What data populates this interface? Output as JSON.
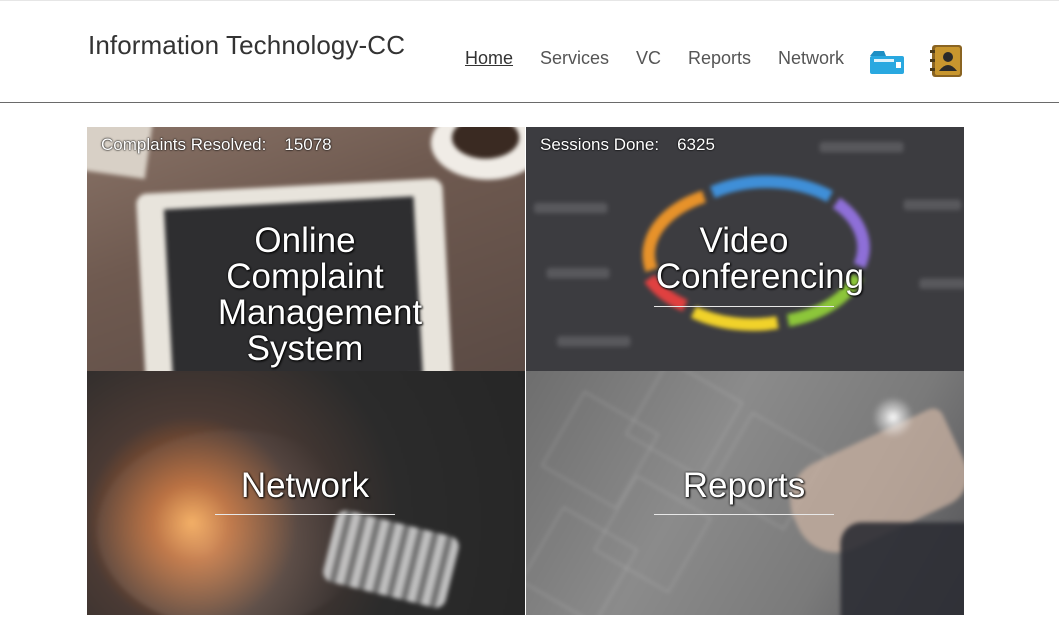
{
  "header": {
    "brand": "Information Technology-CC",
    "nav": [
      {
        "label": "Home",
        "active": true
      },
      {
        "label": "Services"
      },
      {
        "label": "VC"
      },
      {
        "label": "Reports"
      },
      {
        "label": "Network"
      }
    ],
    "documents_icon": "documents-icon",
    "contacts_icon": "address-book-icon"
  },
  "tiles": {
    "complaints": {
      "counter_label": "Complaints Resolved:",
      "counter_value": "15078",
      "title_lines": [
        "Online",
        "Complaint",
        "Management",
        "System"
      ]
    },
    "vc": {
      "counter_label": "Sessions Done:",
      "counter_value": "6325",
      "title_lines": [
        "Video",
        "Conferencing"
      ]
    },
    "network": {
      "title": "Network"
    },
    "reports": {
      "title": "Reports"
    }
  },
  "colors": {
    "divider": "#6a6a6a",
    "nav_text": "#555555",
    "brand_text": "#333333",
    "doc_icon": "#29a8e0",
    "contact_icon": "#a27b2c"
  }
}
